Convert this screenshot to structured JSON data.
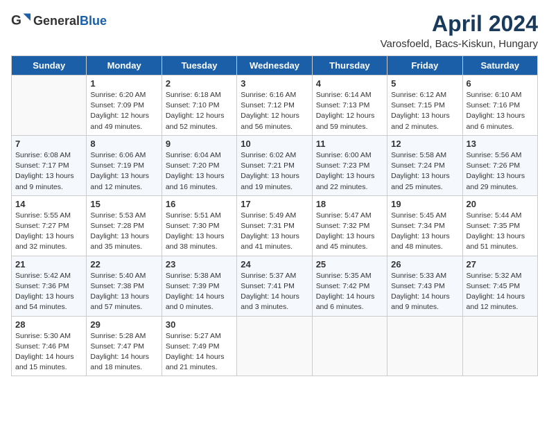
{
  "header": {
    "logo_general": "General",
    "logo_blue": "Blue",
    "title": "April 2024",
    "location": "Varosfoeld, Bacs-Kiskun, Hungary"
  },
  "weekdays": [
    "Sunday",
    "Monday",
    "Tuesday",
    "Wednesday",
    "Thursday",
    "Friday",
    "Saturday"
  ],
  "weeks": [
    [
      {
        "day": "",
        "sunrise": "",
        "sunset": "",
        "daylight": ""
      },
      {
        "day": "1",
        "sunrise": "Sunrise: 6:20 AM",
        "sunset": "Sunset: 7:09 PM",
        "daylight": "Daylight: 12 hours and 49 minutes."
      },
      {
        "day": "2",
        "sunrise": "Sunrise: 6:18 AM",
        "sunset": "Sunset: 7:10 PM",
        "daylight": "Daylight: 12 hours and 52 minutes."
      },
      {
        "day": "3",
        "sunrise": "Sunrise: 6:16 AM",
        "sunset": "Sunset: 7:12 PM",
        "daylight": "Daylight: 12 hours and 56 minutes."
      },
      {
        "day": "4",
        "sunrise": "Sunrise: 6:14 AM",
        "sunset": "Sunset: 7:13 PM",
        "daylight": "Daylight: 12 hours and 59 minutes."
      },
      {
        "day": "5",
        "sunrise": "Sunrise: 6:12 AM",
        "sunset": "Sunset: 7:15 PM",
        "daylight": "Daylight: 13 hours and 2 minutes."
      },
      {
        "day": "6",
        "sunrise": "Sunrise: 6:10 AM",
        "sunset": "Sunset: 7:16 PM",
        "daylight": "Daylight: 13 hours and 6 minutes."
      }
    ],
    [
      {
        "day": "7",
        "sunrise": "Sunrise: 6:08 AM",
        "sunset": "Sunset: 7:17 PM",
        "daylight": "Daylight: 13 hours and 9 minutes."
      },
      {
        "day": "8",
        "sunrise": "Sunrise: 6:06 AM",
        "sunset": "Sunset: 7:19 PM",
        "daylight": "Daylight: 13 hours and 12 minutes."
      },
      {
        "day": "9",
        "sunrise": "Sunrise: 6:04 AM",
        "sunset": "Sunset: 7:20 PM",
        "daylight": "Daylight: 13 hours and 16 minutes."
      },
      {
        "day": "10",
        "sunrise": "Sunrise: 6:02 AM",
        "sunset": "Sunset: 7:21 PM",
        "daylight": "Daylight: 13 hours and 19 minutes."
      },
      {
        "day": "11",
        "sunrise": "Sunrise: 6:00 AM",
        "sunset": "Sunset: 7:23 PM",
        "daylight": "Daylight: 13 hours and 22 minutes."
      },
      {
        "day": "12",
        "sunrise": "Sunrise: 5:58 AM",
        "sunset": "Sunset: 7:24 PM",
        "daylight": "Daylight: 13 hours and 25 minutes."
      },
      {
        "day": "13",
        "sunrise": "Sunrise: 5:56 AM",
        "sunset": "Sunset: 7:26 PM",
        "daylight": "Daylight: 13 hours and 29 minutes."
      }
    ],
    [
      {
        "day": "14",
        "sunrise": "Sunrise: 5:55 AM",
        "sunset": "Sunset: 7:27 PM",
        "daylight": "Daylight: 13 hours and 32 minutes."
      },
      {
        "day": "15",
        "sunrise": "Sunrise: 5:53 AM",
        "sunset": "Sunset: 7:28 PM",
        "daylight": "Daylight: 13 hours and 35 minutes."
      },
      {
        "day": "16",
        "sunrise": "Sunrise: 5:51 AM",
        "sunset": "Sunset: 7:30 PM",
        "daylight": "Daylight: 13 hours and 38 minutes."
      },
      {
        "day": "17",
        "sunrise": "Sunrise: 5:49 AM",
        "sunset": "Sunset: 7:31 PM",
        "daylight": "Daylight: 13 hours and 41 minutes."
      },
      {
        "day": "18",
        "sunrise": "Sunrise: 5:47 AM",
        "sunset": "Sunset: 7:32 PM",
        "daylight": "Daylight: 13 hours and 45 minutes."
      },
      {
        "day": "19",
        "sunrise": "Sunrise: 5:45 AM",
        "sunset": "Sunset: 7:34 PM",
        "daylight": "Daylight: 13 hours and 48 minutes."
      },
      {
        "day": "20",
        "sunrise": "Sunrise: 5:44 AM",
        "sunset": "Sunset: 7:35 PM",
        "daylight": "Daylight: 13 hours and 51 minutes."
      }
    ],
    [
      {
        "day": "21",
        "sunrise": "Sunrise: 5:42 AM",
        "sunset": "Sunset: 7:36 PM",
        "daylight": "Daylight: 13 hours and 54 minutes."
      },
      {
        "day": "22",
        "sunrise": "Sunrise: 5:40 AM",
        "sunset": "Sunset: 7:38 PM",
        "daylight": "Daylight: 13 hours and 57 minutes."
      },
      {
        "day": "23",
        "sunrise": "Sunrise: 5:38 AM",
        "sunset": "Sunset: 7:39 PM",
        "daylight": "Daylight: 14 hours and 0 minutes."
      },
      {
        "day": "24",
        "sunrise": "Sunrise: 5:37 AM",
        "sunset": "Sunset: 7:41 PM",
        "daylight": "Daylight: 14 hours and 3 minutes."
      },
      {
        "day": "25",
        "sunrise": "Sunrise: 5:35 AM",
        "sunset": "Sunset: 7:42 PM",
        "daylight": "Daylight: 14 hours and 6 minutes."
      },
      {
        "day": "26",
        "sunrise": "Sunrise: 5:33 AM",
        "sunset": "Sunset: 7:43 PM",
        "daylight": "Daylight: 14 hours and 9 minutes."
      },
      {
        "day": "27",
        "sunrise": "Sunrise: 5:32 AM",
        "sunset": "Sunset: 7:45 PM",
        "daylight": "Daylight: 14 hours and 12 minutes."
      }
    ],
    [
      {
        "day": "28",
        "sunrise": "Sunrise: 5:30 AM",
        "sunset": "Sunset: 7:46 PM",
        "daylight": "Daylight: 14 hours and 15 minutes."
      },
      {
        "day": "29",
        "sunrise": "Sunrise: 5:28 AM",
        "sunset": "Sunset: 7:47 PM",
        "daylight": "Daylight: 14 hours and 18 minutes."
      },
      {
        "day": "30",
        "sunrise": "Sunrise: 5:27 AM",
        "sunset": "Sunset: 7:49 PM",
        "daylight": "Daylight: 14 hours and 21 minutes."
      },
      {
        "day": "",
        "sunrise": "",
        "sunset": "",
        "daylight": ""
      },
      {
        "day": "",
        "sunrise": "",
        "sunset": "",
        "daylight": ""
      },
      {
        "day": "",
        "sunrise": "",
        "sunset": "",
        "daylight": ""
      },
      {
        "day": "",
        "sunrise": "",
        "sunset": "",
        "daylight": ""
      }
    ]
  ]
}
